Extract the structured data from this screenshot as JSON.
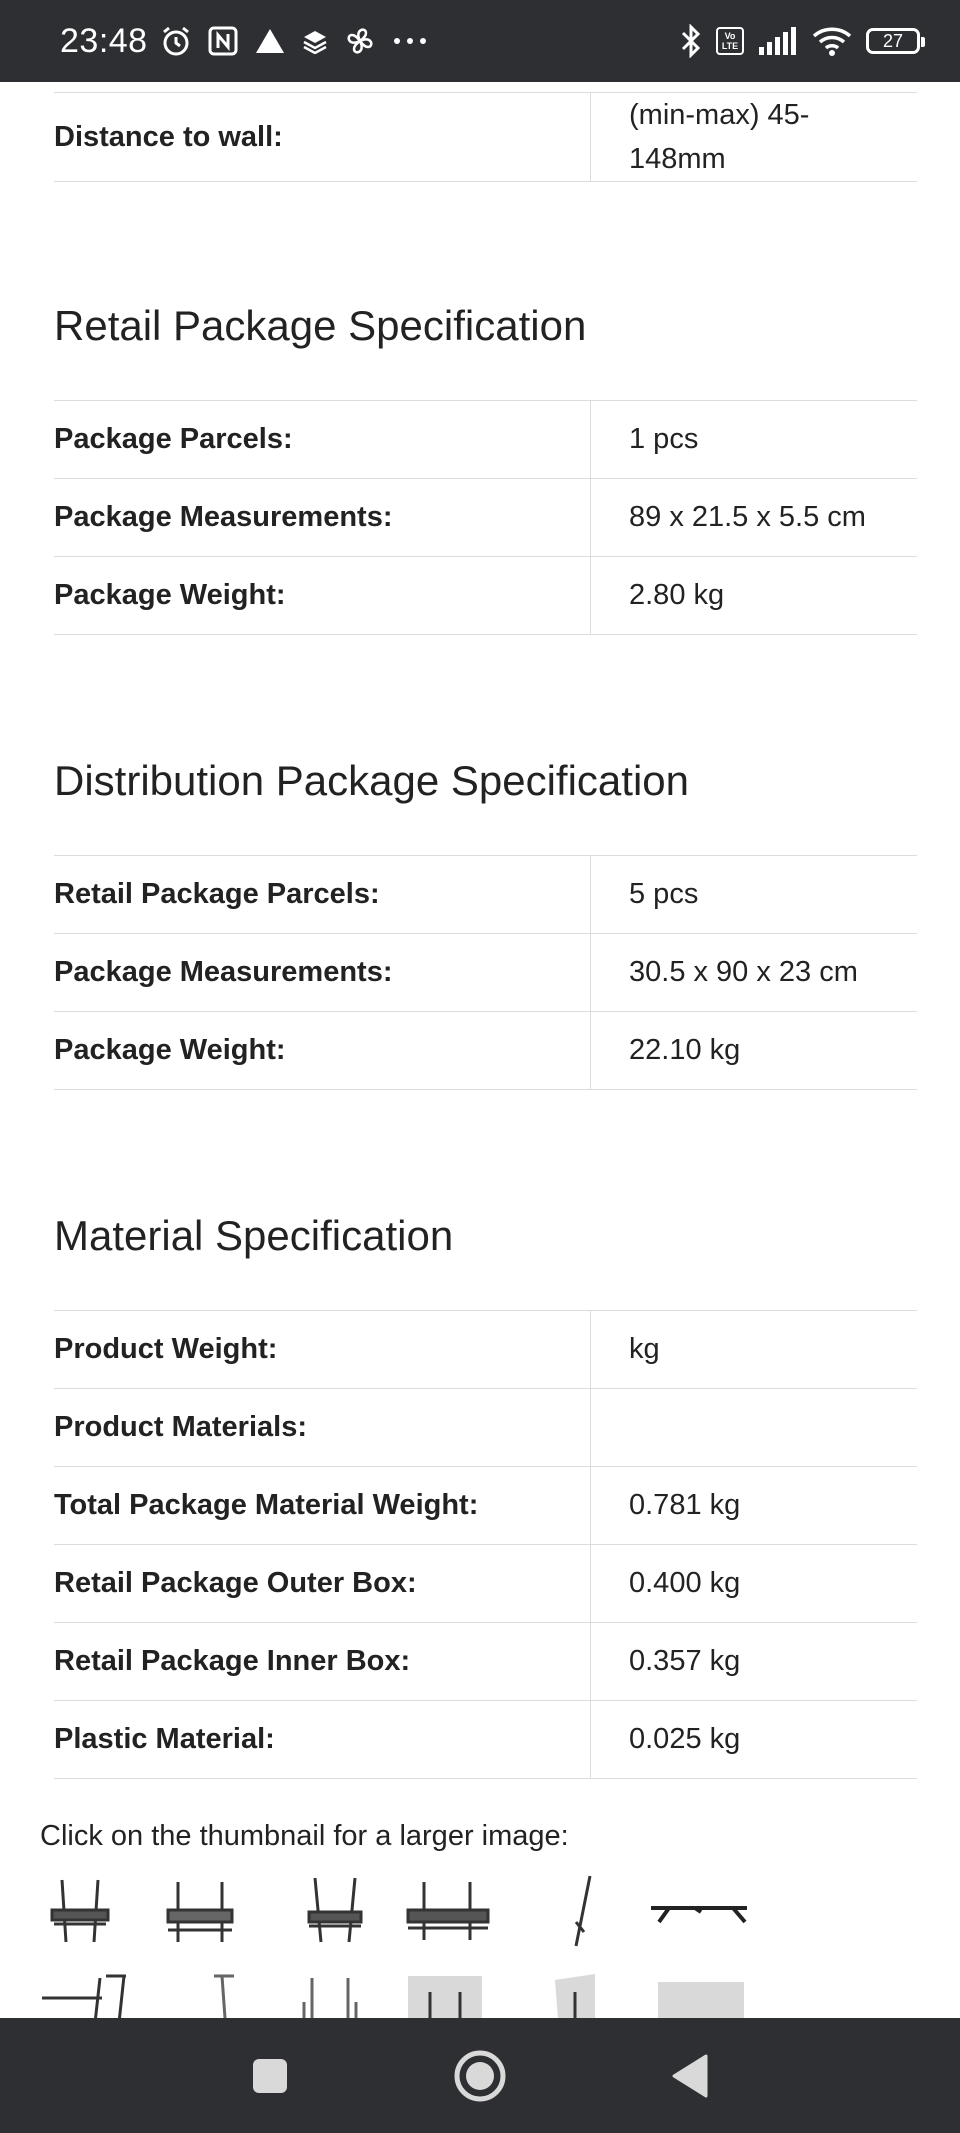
{
  "status_bar": {
    "time": "23:48",
    "left_icons": [
      "alarm-icon",
      "nfc-icon",
      "drive-icon",
      "layers-icon",
      "fan-icon",
      "more-dots-icon"
    ],
    "right_icons": [
      "bluetooth-icon",
      "volte-icon",
      "signal-icon",
      "wifi-icon",
      "battery-icon"
    ],
    "volte_top": "Vo",
    "volte_bottom": "LTE",
    "battery_level": "27"
  },
  "top_row": {
    "label": "Distance to wall:",
    "value_line1": "(min-max) 45-",
    "value_line2": "148mm"
  },
  "sections": {
    "retail": {
      "title": "Retail Package Specification",
      "rows": [
        {
          "label": "Package Parcels:",
          "value": "1 pcs"
        },
        {
          "label": "Package Measurements:",
          "value": "89 x 21.5 x 5.5 cm"
        },
        {
          "label": "Package Weight:",
          "value": "2.80 kg"
        }
      ]
    },
    "distribution": {
      "title": "Distribution Package Specification",
      "rows": [
        {
          "label": "Retail Package Parcels:",
          "value": "5 pcs"
        },
        {
          "label": "Package Measurements:",
          "value": "30.5 x 90 x 23 cm"
        },
        {
          "label": "Package Weight:",
          "value": "22.10 kg"
        }
      ]
    },
    "material": {
      "title": "Material Specification",
      "rows": [
        {
          "label": "Product Weight:",
          "value": "kg"
        },
        {
          "label": "Product Materials:",
          "value": ""
        },
        {
          "label": "Total Package Material Weight:",
          "value": "0.781 kg"
        },
        {
          "label": "Retail Package Outer Box:",
          "value": "0.400 kg"
        },
        {
          "label": "Retail Package Inner Box:",
          "value": "0.357 kg"
        },
        {
          "label": "Plastic Material:",
          "value": "0.025 kg"
        }
      ]
    }
  },
  "thumbnails": {
    "caption": "Click on the thumbnail for a larger image:"
  },
  "nav_bar": {
    "buttons": [
      "recents-square-icon",
      "home-circle-icon",
      "back-triangle-icon"
    ]
  }
}
